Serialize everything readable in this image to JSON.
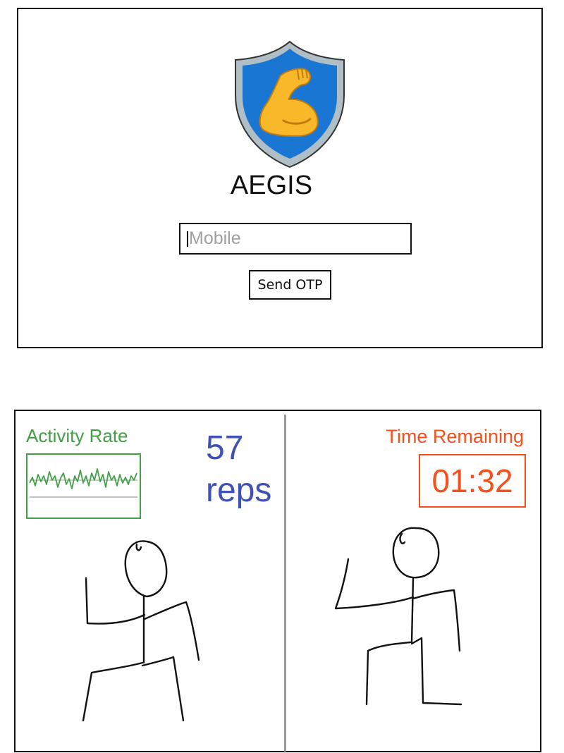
{
  "login": {
    "app_name": "AEGIS",
    "logo_icon": "flexed-biceps-shield-icon",
    "mobile_placeholder": "Mobile",
    "mobile_value": "",
    "send_otp_label": "Send OTP",
    "colors": {
      "shield_fill": "#1976d2",
      "shield_rim": "#b0bec5",
      "bicep": "#f9b72a"
    }
  },
  "workout": {
    "activity_label": "Activity Rate",
    "reps_count": "57",
    "reps_unit": "reps",
    "time_label": "Time Remaining",
    "time_value": "01:32",
    "user_figure": "stick-figure-user-icon",
    "trainer_figure": "stick-figure-trainer-icon",
    "colors": {
      "activity": "#43a047",
      "reps": "#3f51b5",
      "timer": "#f4511e"
    }
  }
}
